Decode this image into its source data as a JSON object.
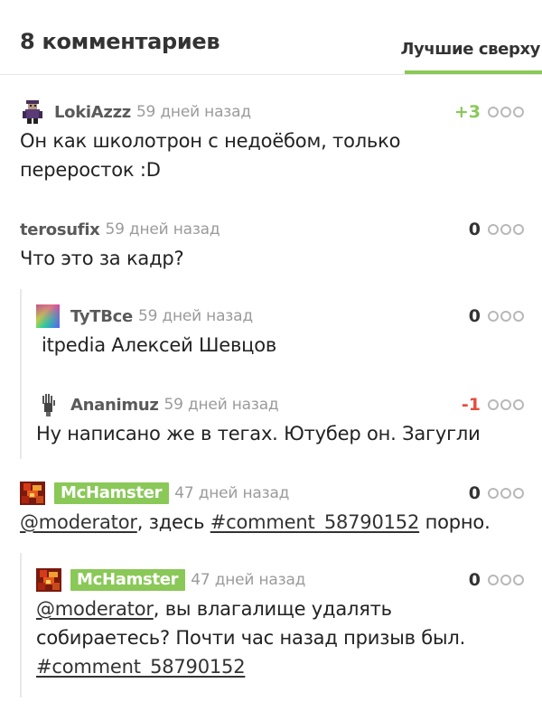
{
  "header": {
    "comments_count_title": "8 комментариев",
    "sort_label": "Лучшие сверху"
  },
  "colors": {
    "accent": "#8ac858",
    "negative": "#e74c3c",
    "meta": "#9b9b9b"
  },
  "comments": [
    {
      "author": "LokiAzzz",
      "time": "59 дней назад",
      "rating": "+3",
      "line1": "Он как школотрон с недоёбом, только",
      "line2": "переросток :D",
      "avatar_icon": "pixel-character-avatar-icon"
    },
    {
      "author": "terosufix",
      "time": "59 дней назад",
      "rating": "0",
      "text": "Что это за кадр?"
    },
    {
      "author": "TyTBce",
      "time": "59 дней назад",
      "rating": "0",
      "text": "itpedia Алексей Шевцов",
      "avatar_icon": "gradient-square-avatar-icon"
    },
    {
      "author": "Ananimuz",
      "time": "59 дней назад",
      "rating": "-1",
      "text": "Ну написано же в тегах. Ютубер он. Загугли",
      "avatar_icon": "hand-avatar-icon"
    },
    {
      "author": "McHamster",
      "time": "47 дней назад",
      "rating": "0",
      "mention": "@moderator",
      "mid": ", здесь ",
      "link": "#comment_58790152",
      "tail": " порно.",
      "avatar_icon": "fiery-avatar-icon"
    },
    {
      "author": "McHamster",
      "time": "47 дней назад",
      "rating": "0",
      "mention": "@moderator",
      "line1_rest": ", вы влагалище удалять",
      "line2": "собираетесь? Почти час назад призыв был.",
      "link": "#comment_58790152",
      "avatar_icon": "fiery-avatar-icon"
    }
  ]
}
